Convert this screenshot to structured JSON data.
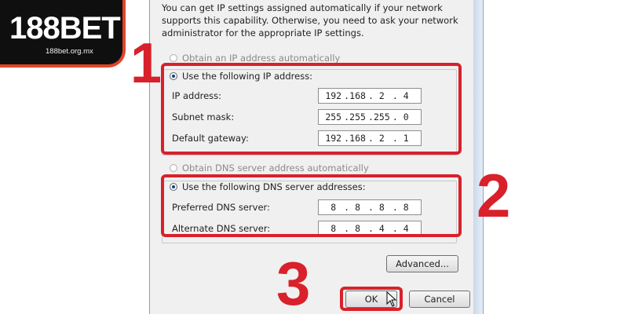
{
  "brand": {
    "logo_main": "188BET",
    "logo_sub": "188bet.org.mx"
  },
  "intro_text": "You can get IP settings assigned automatically if your network supports this capability. Otherwise, you need to ask your network administrator for the appropriate IP settings.",
  "ip_section": {
    "auto_option": "Obtain an IP address automatically",
    "manual_option": "Use the following IP address:",
    "fields": [
      {
        "label": "IP address:",
        "octets": [
          "192",
          "168",
          "2",
          "4"
        ]
      },
      {
        "label": "Subnet mask:",
        "octets": [
          "255",
          "255",
          "255",
          "0"
        ]
      },
      {
        "label": "Default gateway:",
        "octets": [
          "192",
          "168",
          "2",
          "1"
        ]
      }
    ]
  },
  "dns_section": {
    "auto_option": "Obtain DNS server address automatically",
    "manual_option": "Use the following DNS server addresses:",
    "fields": [
      {
        "label": "Preferred DNS server:",
        "octets": [
          "8",
          "8",
          "8",
          "8"
        ]
      },
      {
        "label": "Alternate DNS server:",
        "octets": [
          "8",
          "8",
          "4",
          "4"
        ]
      }
    ]
  },
  "buttons": {
    "advanced": "Advanced...",
    "ok": "OK",
    "cancel": "Cancel"
  },
  "step_numbers": [
    "1",
    "2",
    "3"
  ],
  "colors": {
    "highlight": "#d8212b",
    "logo_accent": "#f0672f"
  },
  "icons": [
    "mouse-cursor-icon"
  ]
}
